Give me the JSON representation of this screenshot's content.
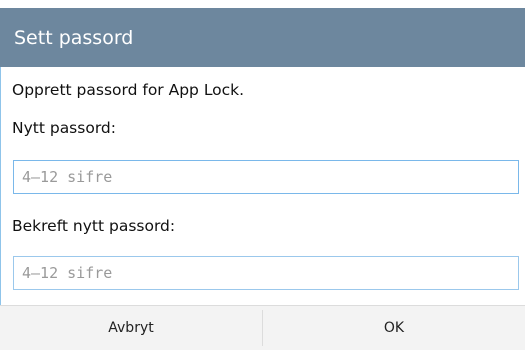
{
  "dialog": {
    "title": "Sett passord",
    "description": "Opprett passord for App Lock.",
    "new_password_label": "Nytt passord:",
    "new_password_placeholder": "4–12 sifre",
    "new_password_value": "",
    "confirm_password_label": "Bekreft nytt passord:",
    "confirm_password_placeholder": "4–12 sifre",
    "confirm_password_value": "",
    "cancel_label": "Avbryt",
    "ok_label": "OK"
  },
  "colors": {
    "title_bar": "#6d879e",
    "input_border": "#9bc8ec",
    "footer": "#f3f3f3"
  }
}
